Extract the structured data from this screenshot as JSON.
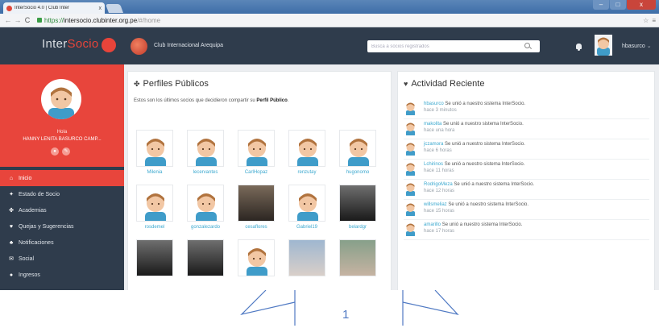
{
  "browser": {
    "tab_title": "InterSocio 4.0 | Club Inter",
    "tab_close": "x",
    "url_scheme": "https://",
    "url_host": "intersocio.clubinter.org.pe",
    "url_path": "/#/home",
    "win_min": "–",
    "win_max": "□",
    "win_close": "x"
  },
  "header": {
    "brand_main": "Inter",
    "brand_accent": "Socio",
    "club_name": "Club Internacional Arequipa",
    "search_placeholder": "Busca a socios registrados",
    "user_name": "hbasurco"
  },
  "sidebar": {
    "greeting": "Hola",
    "full_name": "HANNY LENITA BASURCO CAMP...",
    "items": [
      {
        "label": "Inicio",
        "icon": "home-icon",
        "glyph": "⌂",
        "active": true
      },
      {
        "label": "Estado de Socio",
        "icon": "pin-icon",
        "glyph": "✦",
        "active": false
      },
      {
        "label": "Academias",
        "icon": "group-icon",
        "glyph": "✤",
        "active": false
      },
      {
        "label": "Quejas y Sugerencias",
        "icon": "heart-icon",
        "glyph": "♥",
        "active": false
      },
      {
        "label": "Notificaciones",
        "icon": "bell-icon",
        "glyph": "♣",
        "active": false
      },
      {
        "label": "Social",
        "icon": "chat-icon",
        "glyph": "✉",
        "active": false
      },
      {
        "label": "Ingresos",
        "icon": "info-icon",
        "glyph": "●",
        "active": false
      }
    ]
  },
  "perfiles": {
    "title": "Perfiles Públicos",
    "desc_prefix": "Estos son los últimos socios que decidieron compartir su ",
    "desc_bold": "Perfil Público",
    "desc_suffix": ".",
    "profiles": [
      {
        "name": "Milenia",
        "photo": "avatar"
      },
      {
        "name": "lecervantes",
        "photo": "avatar"
      },
      {
        "name": "CarlHopaz",
        "photo": "avatar"
      },
      {
        "name": "renzutay",
        "photo": "avatar"
      },
      {
        "name": "hugonomo",
        "photo": "avatar"
      },
      {
        "name": "rosdemel",
        "photo": "avatar"
      },
      {
        "name": "gonzalezardo",
        "photo": "avatar"
      },
      {
        "name": "cesaflores",
        "photo": "dark"
      },
      {
        "name": "Gabriel19",
        "photo": "avatar"
      },
      {
        "name": "belardgr",
        "photo": "darker"
      },
      {
        "name": "",
        "photo": "darker"
      },
      {
        "name": "",
        "photo": "darker"
      },
      {
        "name": "",
        "photo": "avatar"
      },
      {
        "name": "",
        "photo": "blue"
      },
      {
        "name": "",
        "photo": "green"
      }
    ]
  },
  "actividad": {
    "title": "Actividad Reciente",
    "items": [
      {
        "user": "hbasurco",
        "action": "Se unió a nuestro sistema InterSocio.",
        "time": "hace 3 minutos"
      },
      {
        "user": "makolita",
        "action": "Se unió a nuestro sistema InterSocio.",
        "time": "hace una hora"
      },
      {
        "user": "jczamora",
        "action": "Se unió a nuestro sistema InterSocio.",
        "time": "hace 6 horas"
      },
      {
        "user": "Lchirinos",
        "action": "Se unió a nuestro sistema InterSocio.",
        "time": "hace 11 horas"
      },
      {
        "user": "RodrigoMeza",
        "action": "Se unió a nuestro sistema InterSocio.",
        "time": "hace 12 horas"
      },
      {
        "user": "willsmeliaz",
        "action": "Se unió a nuestro sistema InterSocio.",
        "time": "hace 15 horas"
      },
      {
        "user": "amarillo",
        "action": "Se unió a nuestro sistema InterSocio.",
        "time": "hace 17 horas"
      }
    ]
  },
  "annotation": {
    "label": "1",
    "color": "#4f79c3"
  }
}
